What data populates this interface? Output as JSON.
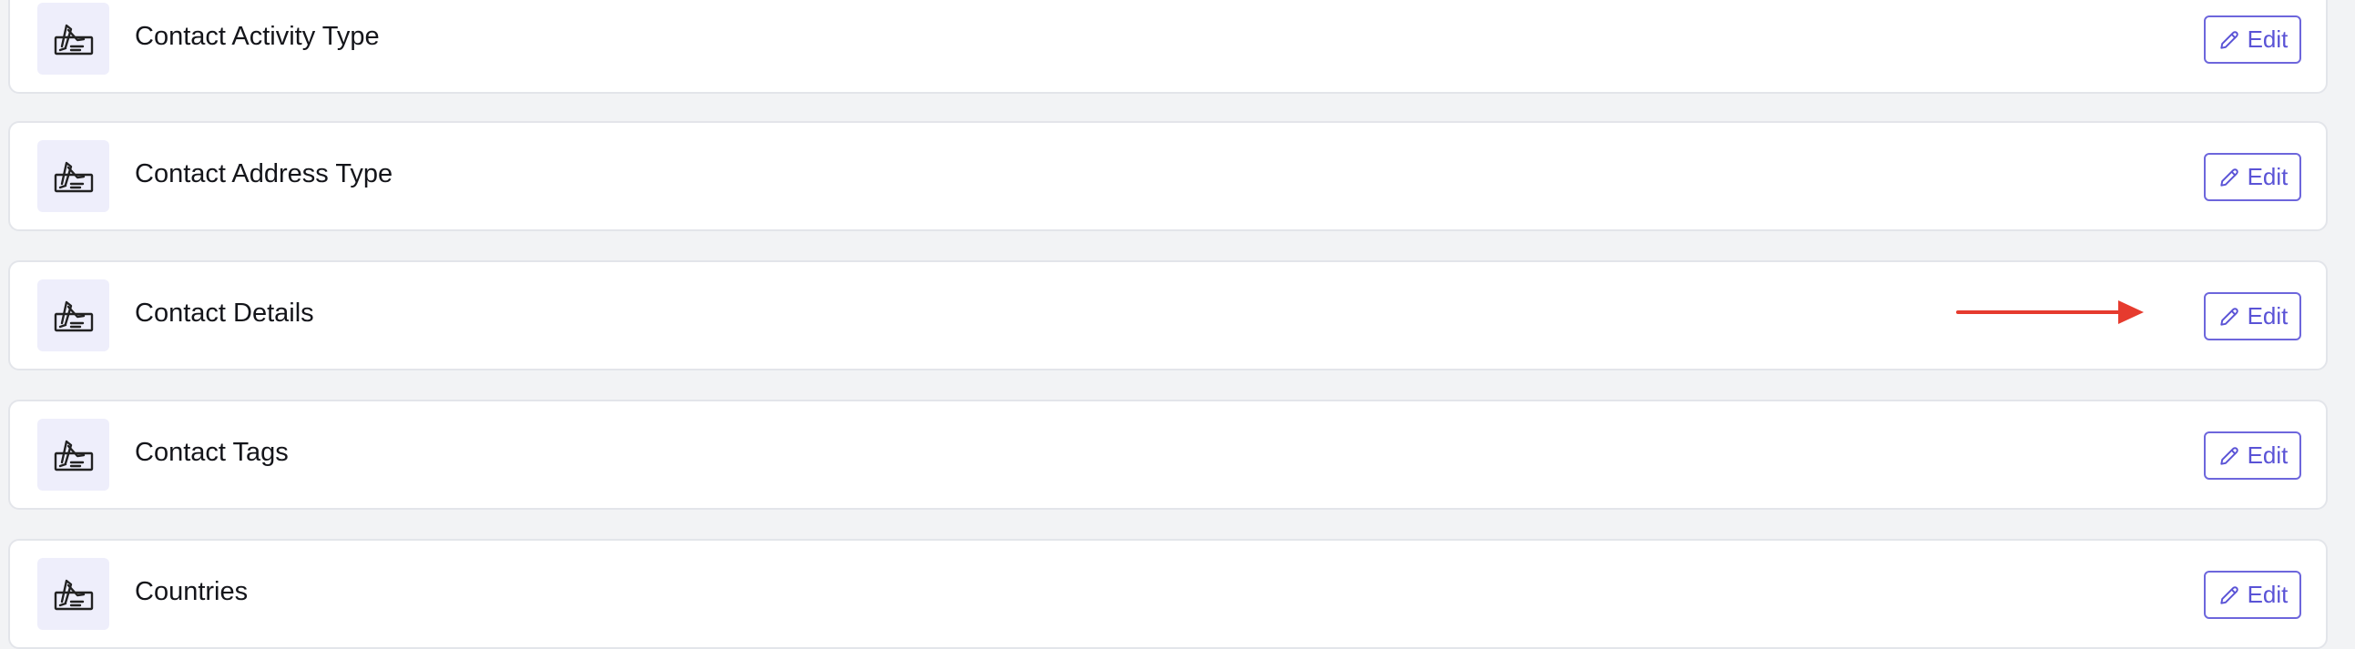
{
  "rows": [
    {
      "label": "Contact Activity Type",
      "edit_label": "Edit",
      "icon": "signature-icon"
    },
    {
      "label": "Contact Address Type",
      "edit_label": "Edit",
      "icon": "signature-icon"
    },
    {
      "label": "Contact Details",
      "edit_label": "Edit",
      "icon": "signature-icon"
    },
    {
      "label": "Contact Tags",
      "edit_label": "Edit",
      "icon": "signature-icon"
    },
    {
      "label": "Countries",
      "edit_label": "Edit",
      "icon": "signature-icon"
    }
  ],
  "annotation": {
    "type": "arrow",
    "color": "#e63b2e",
    "points_to": "Contact Details edit button"
  },
  "colors": {
    "background": "#f2f3f5",
    "card": "#ffffff",
    "accent": "#5a53d6",
    "icon_tile": "#eeeefb"
  }
}
